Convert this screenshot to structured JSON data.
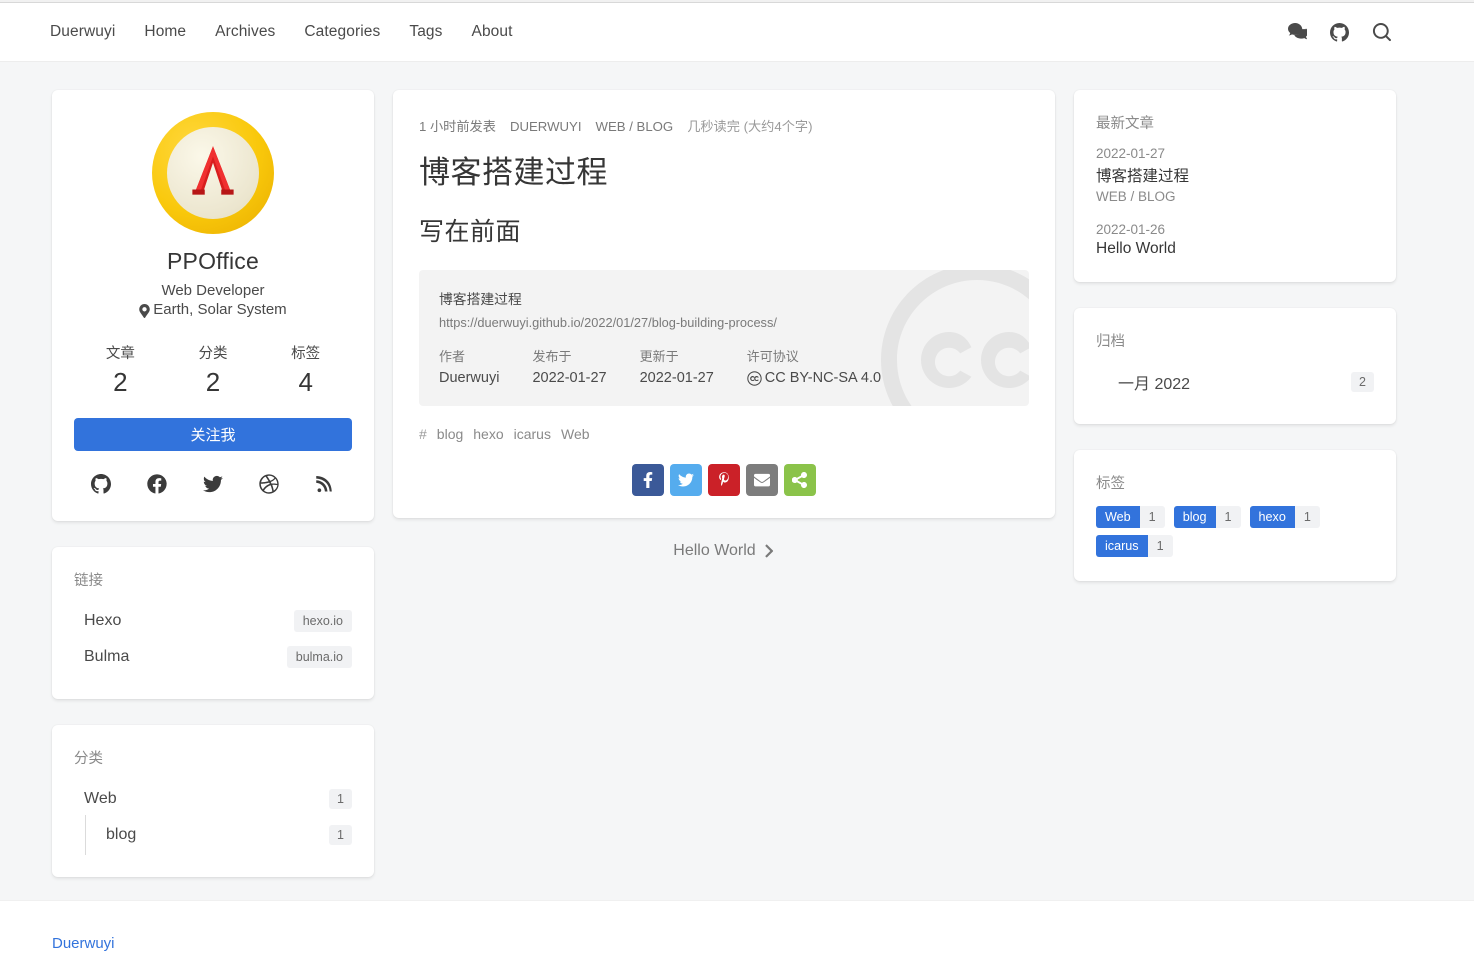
{
  "navbar": {
    "brand": "Duerwuyi",
    "items": [
      {
        "label": "Home"
      },
      {
        "label": "Archives"
      },
      {
        "label": "Categories"
      },
      {
        "label": "Tags"
      },
      {
        "label": "About"
      }
    ],
    "icons": [
      {
        "name": "comments-icon"
      },
      {
        "name": "github-icon"
      },
      {
        "name": "search-icon"
      }
    ]
  },
  "profile": {
    "avatar_alt": "PPOffice lambda logo",
    "name": "PPOffice",
    "role": "Web Developer",
    "location": "Earth, Solar System",
    "stats": [
      {
        "label": "文章",
        "value": "2"
      },
      {
        "label": "分类",
        "value": "2"
      },
      {
        "label": "标签",
        "value": "4"
      }
    ],
    "follow_label": "关注我",
    "follow_color": "#3273dc",
    "socials": [
      "github-icon",
      "facebook-icon",
      "twitter-icon",
      "dribbble-icon",
      "rss-icon"
    ]
  },
  "links_widget": {
    "title": "链接",
    "items": [
      {
        "name": "Hexo",
        "url_label": "hexo.io"
      },
      {
        "name": "Bulma",
        "url_label": "bulma.io"
      }
    ]
  },
  "categories_widget": {
    "title": "分类",
    "items": [
      {
        "name": "Web",
        "count": "1",
        "child": false
      },
      {
        "name": "blog",
        "count": "1",
        "child": true
      }
    ]
  },
  "article": {
    "meta": {
      "published": "1 小时前发表",
      "author": "DUERWUYI",
      "categories": "WEB / BLOG",
      "read_time": "几秒读完 (大约4个字)"
    },
    "title": "博客搭建过程",
    "heading": "写在前面",
    "license": {
      "post_title": "博客搭建过程",
      "url": "https://duerwuyi.github.io/2022/01/27/blog-building-process/",
      "fields": [
        {
          "label": "作者",
          "value": "Duerwuyi"
        },
        {
          "label": "发布于",
          "value": "2022-01-27"
        },
        {
          "label": "更新于",
          "value": "2022-01-27"
        },
        {
          "label": "许可协议",
          "value": "CC BY-NC-SA 4.0"
        }
      ]
    },
    "tags_prefix": "#",
    "tags": [
      "blog",
      "hexo",
      "icarus",
      "Web"
    ],
    "share_buttons": [
      {
        "name": "facebook-share-button",
        "color": "#3b5998"
      },
      {
        "name": "twitter-share-button",
        "color": "#55acee"
      },
      {
        "name": "pinterest-share-button",
        "color": "#cb2128"
      },
      {
        "name": "email-share-button",
        "color": "#7d7d7d"
      },
      {
        "name": "more-share-button",
        "color": "#8bc34a"
      }
    ],
    "next_post": "Hello World"
  },
  "recent_widget": {
    "title": "最新文章",
    "items": [
      {
        "date": "2022-01-27",
        "title": "博客搭建过程",
        "categories": "WEB / BLOG"
      },
      {
        "date": "2022-01-26",
        "title": "Hello World",
        "categories": ""
      }
    ]
  },
  "archives_widget": {
    "title": "归档",
    "items": [
      {
        "name": "一月 2022",
        "count": "2"
      }
    ]
  },
  "tags_widget": {
    "title": "标签",
    "items": [
      {
        "label": "Web",
        "count": "1"
      },
      {
        "label": "blog",
        "count": "1"
      },
      {
        "label": "hexo",
        "count": "1"
      },
      {
        "label": "icarus",
        "count": "1"
      }
    ]
  },
  "footer": {
    "brand": "Duerwuyi"
  }
}
